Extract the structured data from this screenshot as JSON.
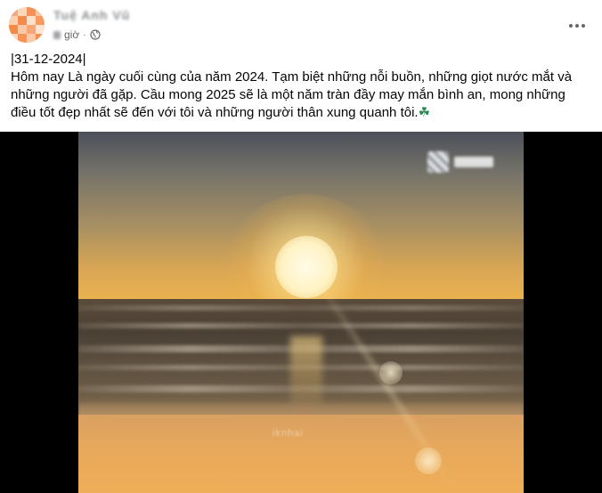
{
  "post": {
    "author": {
      "name": "Tuệ Anh Vũ",
      "avatar_color": "#f7a06a"
    },
    "meta": {
      "time_label": "giờ",
      "separator": "·",
      "privacy_icon": "globe-icon"
    },
    "more_icon": "more-horizontal-icon",
    "caption": {
      "date_line": "|31-12-2024|",
      "body": "Hôm nay Là ngày cuối cùng của năm 2024. Tạm biệt những nỗi buồn, những giọt nước mắt và những người đã gặp. Cầu mong 2025 sẽ là một năm tràn đầy may mắn bình an, mong những điều tốt đẹp nhất sẽ đến với tôi và những người thân xung quanh tôi.",
      "emoji": "☘"
    },
    "media": {
      "type": "photo",
      "subject": "sunset-over-sea",
      "watermark_text": "iknhai"
    }
  }
}
